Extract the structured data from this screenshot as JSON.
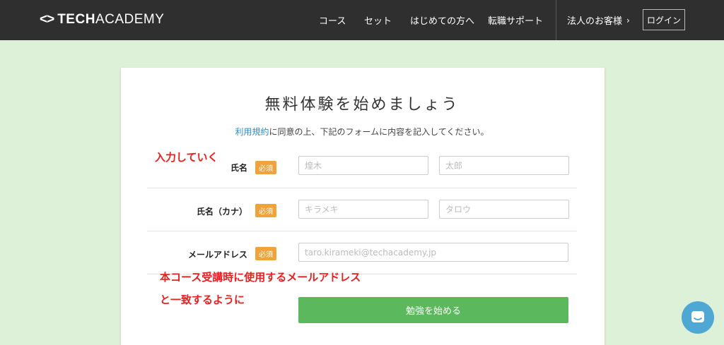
{
  "header": {
    "logo_tech": "TECH",
    "logo_academy": "ACADEMY",
    "nav": [
      "コース",
      "セット",
      "はじめての方へ",
      "転職サポート"
    ],
    "corporate": "法人のお客様",
    "login": "ログイン"
  },
  "form": {
    "title": "無料体験を始めましょう",
    "terms_link": "利用規約",
    "intro_rest": "に同意の上、下記のフォームに内容を記入してください。",
    "required": "必須",
    "name_label": "氏名",
    "last_name_placeholder": "煌木",
    "first_name_placeholder": "太郎",
    "kana_label": "氏名（カナ）",
    "last_kana_placeholder": "キラメキ",
    "first_kana_placeholder": "タロウ",
    "email_label": "メールアドレス",
    "email_placeholder": "taro.kirameki@techacademy.jp",
    "submit": "勉強を始める"
  },
  "annotations": {
    "input_note": "入力していく",
    "email_note_line1": "本コース受講時に使用するメールアドレス",
    "email_note_line2": "と一致するように"
  },
  "colors": {
    "header_bg": "#2f2f2f",
    "page_bg": "#ddf0d8",
    "accent_green": "#5bb85c",
    "badge_orange": "#f0a33b",
    "annotation_red": "#e8201f",
    "chat_blue": "#4fa8d4"
  },
  "icons": {
    "logo_mark": "code-brackets-icon",
    "corporate_arrow": "chevron-right-icon",
    "chat": "chat-icon"
  }
}
